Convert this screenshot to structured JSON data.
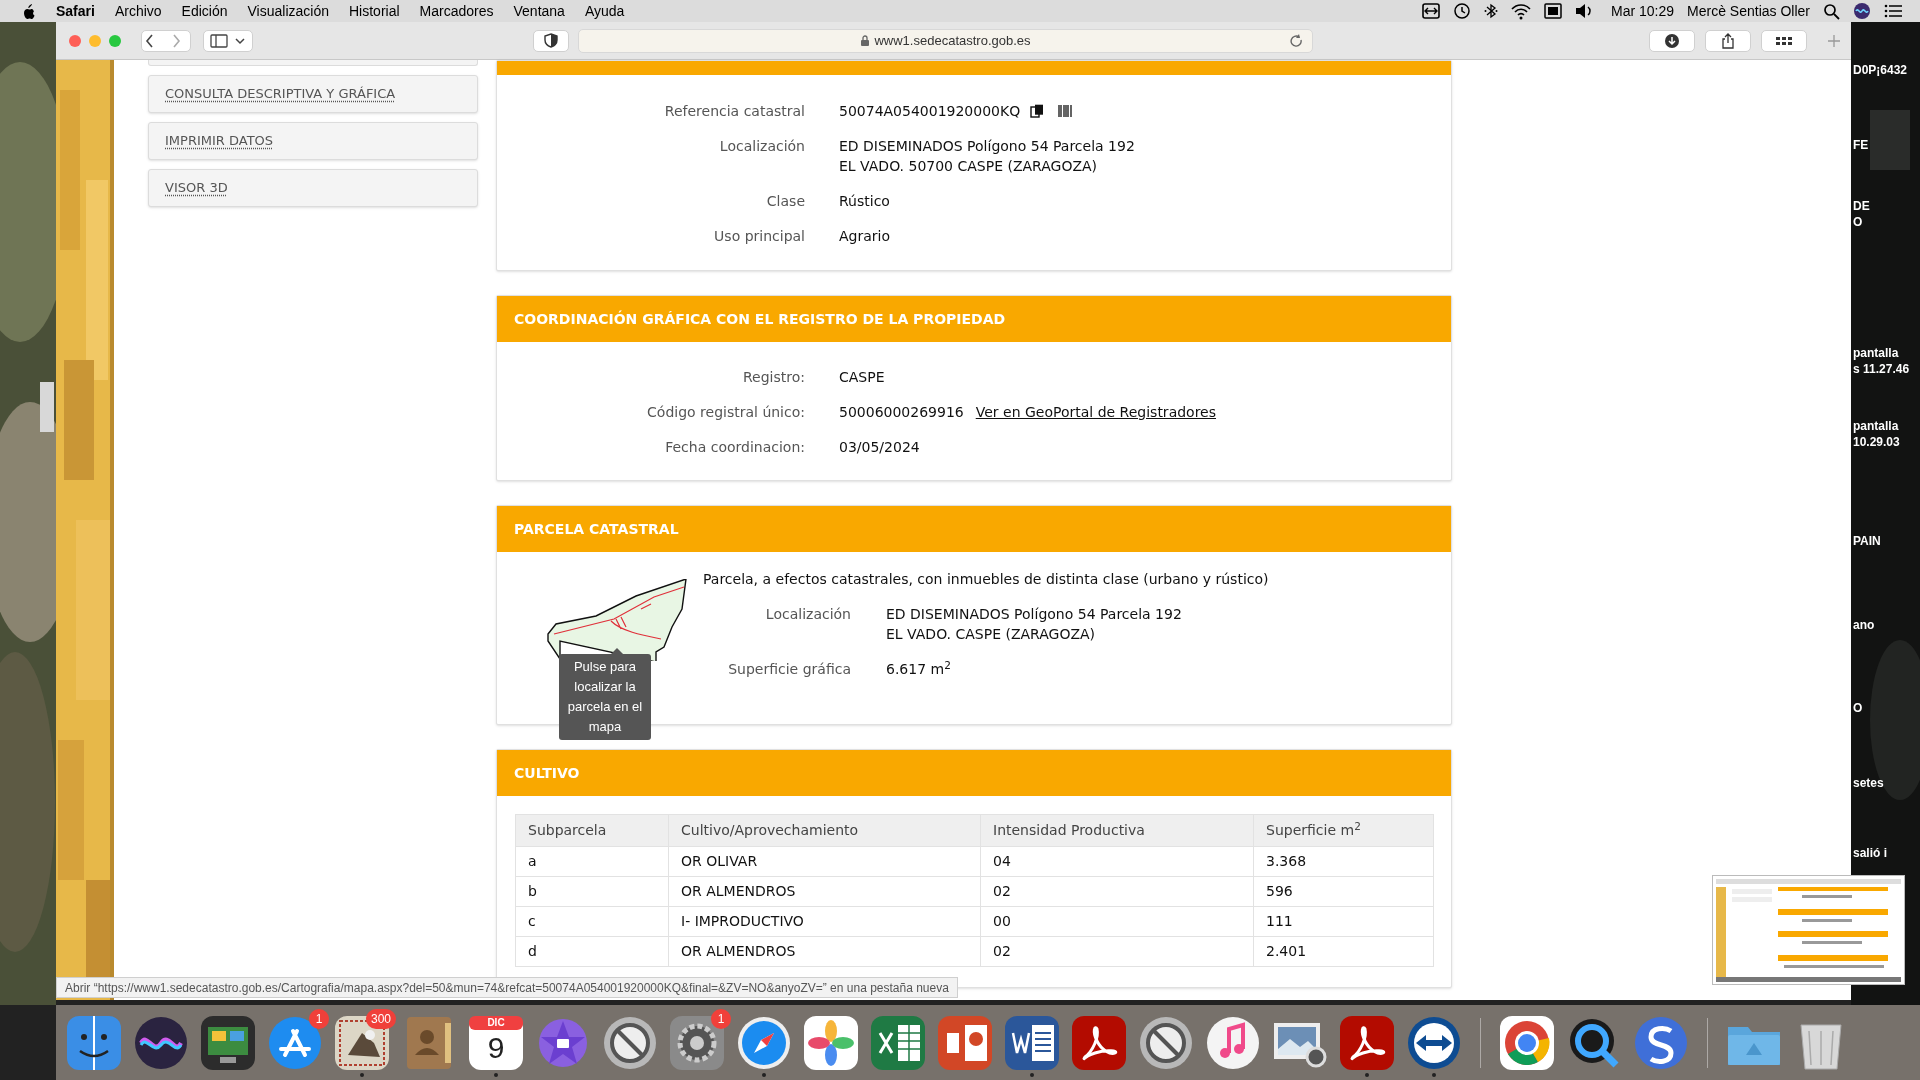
{
  "menu_bar": {
    "app": "Safari",
    "menus": [
      "Archivo",
      "Edición",
      "Visualización",
      "Historial",
      "Marcadores",
      "Ventana",
      "Ayuda"
    ],
    "clock": "Mar 10:29",
    "user": "Mercè Sentias Oller"
  },
  "browser": {
    "url": "www1.sedecatastro.gob.es"
  },
  "sidebar": {
    "links": [
      "CONSULTA DESCRIPTIVA Y GRÁFICA",
      "IMPRIMIR DATOS",
      "VISOR 3D"
    ]
  },
  "property": {
    "fields": [
      {
        "kind": "reference",
        "label": "Referencia catastral",
        "lines": [
          "50074A054001920000KQ"
        ]
      },
      {
        "label": "Localización",
        "lines": [
          "ED DISEMINADOS Polígono 54 Parcela 192",
          "EL VADO. 50700 CASPE (ZARAGOZA)"
        ]
      },
      {
        "label": "Clase",
        "lines": [
          "Rústico"
        ]
      },
      {
        "label": "Uso principal",
        "lines": [
          "Agrario"
        ]
      }
    ]
  },
  "coordination": {
    "title": "COORDINACIÓN GRÁFICA CON EL REGISTRO DE LA PROPIEDAD",
    "fields": [
      {
        "label": "Registro:",
        "lines": [
          "CASPE"
        ]
      },
      {
        "kind": "link",
        "label": "Código registral único:",
        "lines": [
          "50006000269916"
        ],
        "link": "Ver en GeoPortal de Registradores"
      },
      {
        "label": "Fecha coordinacion:",
        "lines": [
          "03/05/2024"
        ]
      }
    ]
  },
  "parcel": {
    "title": "PARCELA CATASTRAL",
    "note": "Parcela, a efectos catastrales, con inmuebles de distinta clase (urbano y rústico)",
    "tooltip": "Pulse para localizar la parcela en el mapa",
    "fields": [
      {
        "label": "Localización",
        "lines": [
          "ED DISEMINADOS Polígono 54 Parcela 192",
          "EL VADO. CASPE (ZARAGOZA)"
        ]
      },
      {
        "label": "Superficie gráfica",
        "lines": [
          "6.617 m$^{2}$"
        ]
      }
    ]
  },
  "crops": {
    "title": "CULTIVO",
    "columns": [
      "Subparcela",
      "Cultivo/Aprovechamiento",
      "Intensidad Productiva",
      "Superficie m$^{2}$"
    ],
    "rows": [
      [
        "a",
        "OR OLIVAR",
        "04",
        "3.368"
      ],
      [
        "b",
        "OR ALMENDROS",
        "02",
        "596"
      ],
      [
        "c",
        "I- IMPRODUCTIVO",
        "00",
        "111"
      ],
      [
        "d",
        "OR ALMENDROS",
        "02",
        "2.401"
      ]
    ]
  },
  "status_link": "Abrir “https://www1.sedecatastro.gob.es/Cartografia/mapa.aspx?del=50&mun=74&refcat=50074A054001920000KQ&final=&ZV=NO&anyoZV=” en una pestaña nueva",
  "desktop_labels": [
    [
      "D0P¡6432"
    ],
    [
      "FE"
    ],
    [
      "DE",
      "O"
    ],
    [
      "pantalla",
      "s 11.27.46"
    ],
    [
      "pantalla",
      "10.29.03"
    ],
    [
      "PAIN"
    ],
    [
      "ano"
    ],
    [
      "O"
    ],
    [
      "setes"
    ],
    [
      "salió i"
    ]
  ],
  "dock": [
    [
      {
        "kind": "face",
        "color": "#3a8ee6",
        "running": false
      },
      {
        "kind": "orb",
        "color": "#2a2340",
        "running": false
      },
      {
        "kind": "screens",
        "color": "#2c2c2c",
        "running": false
      },
      {
        "kind": "pencils",
        "color": "#1e8cf0",
        "running": false,
        "badge": "1"
      },
      {
        "kind": "stamp",
        "color": "#dcd6c6",
        "running": true,
        "badge": "300"
      },
      {
        "kind": "book",
        "color": "#a0784f",
        "running": false
      },
      {
        "kind": "calendar",
        "color": "#ffffff",
        "running": true,
        "month": "DIC",
        "day": "9"
      },
      {
        "kind": "star",
        "color": "#6b3fd0",
        "running": false
      },
      {
        "kind": "no-sign",
        "color": "#b8b8b8",
        "running": false
      },
      {
        "kind": "gear",
        "color": "#8a8a8a",
        "running": false,
        "badge": "1"
      },
      {
        "kind": "compass",
        "color": "#1b8cf0",
        "running": true
      },
      {
        "kind": "flower",
        "color": "#ffffff",
        "running": false
      },
      {
        "kind": "spreadsheet",
        "color": "#1f7a44",
        "running": false
      },
      {
        "kind": "slides",
        "color": "#d24726",
        "running": false
      },
      {
        "kind": "document",
        "color": "#2b579a",
        "running": true
      },
      {
        "kind": "pdf",
        "color": "#b30b00",
        "running": false
      },
      {
        "kind": "no-sign",
        "color": "#b8b8b8",
        "running": false
      },
      {
        "kind": "note",
        "color": "#f4f4f4",
        "running": false
      },
      {
        "kind": "photo-viewer",
        "color": "#6c8fb6",
        "running": false
      },
      {
        "kind": "pdf",
        "color": "#b30b00",
        "running": true
      },
      {
        "kind": "arrows",
        "color": "#0e4c92",
        "running": true
      }
    ],
    [
      {
        "kind": "browser",
        "color": "#ffffff",
        "running": false
      },
      {
        "kind": "magnifier",
        "color": "#1a1a1a",
        "running": false
      },
      {
        "kind": "swirl",
        "color": "#3f6fd8",
        "running": false
      }
    ],
    [
      {
        "kind": "folder",
        "color": "#6fb7e8",
        "running": false
      },
      {
        "kind": "trash",
        "color": "#d8d8d8",
        "running": false
      }
    ]
  ]
}
